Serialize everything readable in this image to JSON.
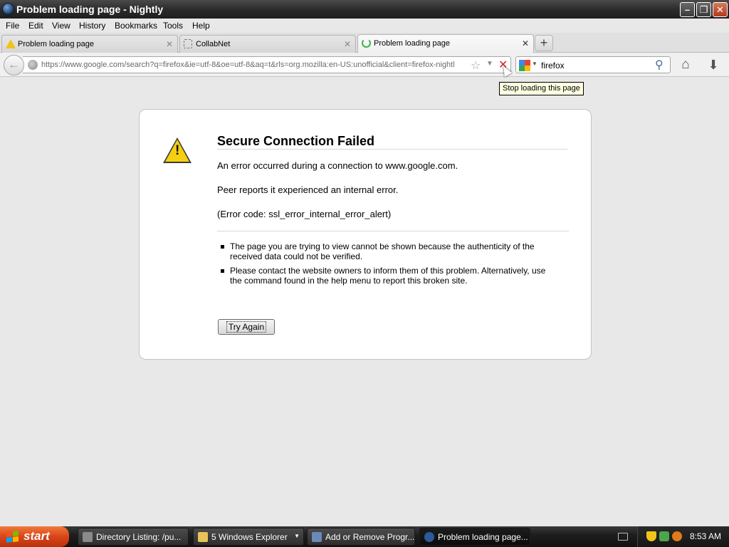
{
  "window": {
    "title": "Problem loading page - Nightly",
    "controls": {
      "minimize": "–",
      "maximize": "❐",
      "close": "✕"
    }
  },
  "menubar": {
    "items": [
      "File",
      "Edit",
      "View",
      "History",
      "Bookmarks",
      "Tools",
      "Help"
    ]
  },
  "tabs": [
    {
      "label": "Problem loading page",
      "icon": "warning-icon",
      "active": false
    },
    {
      "label": "CollabNet",
      "icon": "blank-page-icon",
      "active": false
    },
    {
      "label": "Problem loading page",
      "icon": "loading-spinner-icon",
      "active": true
    }
  ],
  "new_tab_label": "+",
  "navbar": {
    "url": "https://www.google.com/search?q=firefox&ie=utf-8&oe=utf-8&aq=t&rls=org.mozilla:en-US:unofficial&client=firefox-nightl",
    "search_value": "firefox",
    "search_engine": "google-icon"
  },
  "tooltip": "Stop loading this page",
  "error_page": {
    "title": "Secure Connection Failed",
    "lines": [
      "An error occurred during a connection to www.google.com.",
      "Peer reports it experienced an internal error.",
      "(Error code: ssl_error_internal_error_alert)"
    ],
    "bullets": [
      "The page you are trying to view cannot be shown because the authenticity of the received data could not be verified.",
      "Please contact the website owners to inform them of this problem. Alternatively, use the command found in the help menu to report this broken site."
    ],
    "button_label": "Try Again"
  },
  "taskbar": {
    "start_label": "start",
    "tasks": [
      {
        "label": "Directory Listing: /pu...",
        "active": false
      },
      {
        "label": "5 Windows Explorer",
        "active": false
      },
      {
        "label": "Add or Remove Progr...",
        "active": false
      },
      {
        "label": "Problem loading page...",
        "active": true
      }
    ],
    "clock": "8:53 AM"
  },
  "colors": {
    "stop": "#d02020",
    "warning": "#f4cf12",
    "start": "#d9441a",
    "tooltip_bg": "#ffffe1"
  }
}
